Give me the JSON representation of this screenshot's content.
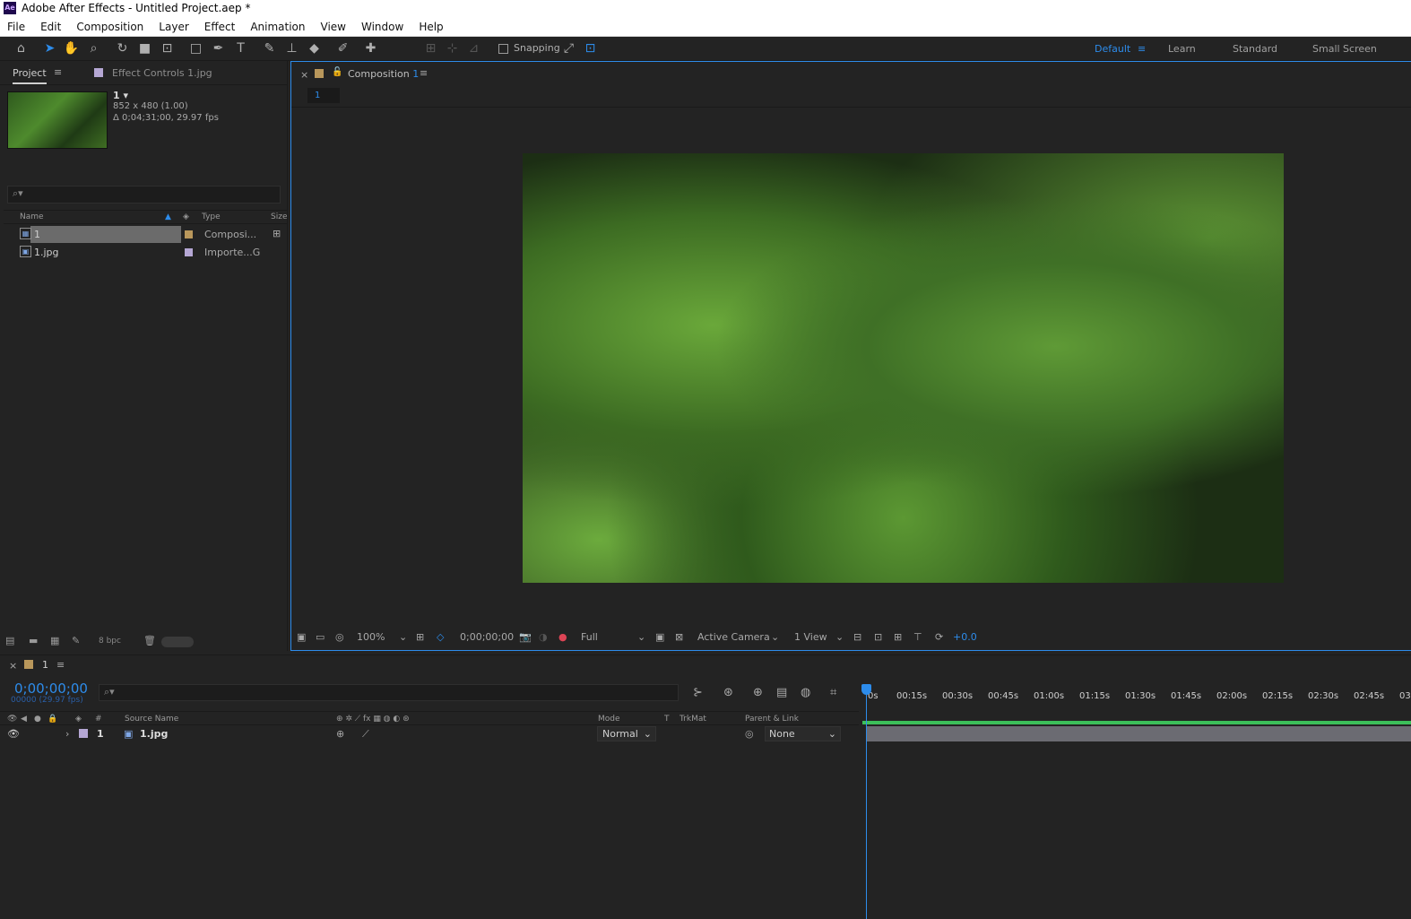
{
  "window": {
    "title": "Adobe After Effects - Untitled Project.aep *",
    "logo": "Ae"
  },
  "menu": [
    "File",
    "Edit",
    "Composition",
    "Layer",
    "Effect",
    "Animation",
    "View",
    "Window",
    "Help"
  ],
  "toolbar": {
    "snapping_label": "Snapping",
    "workspaces": [
      "Default",
      "Learn",
      "Standard",
      "Small Screen"
    ],
    "accent": "#2d8ceb"
  },
  "project": {
    "tab": "Project",
    "effect_controls_tab": "Effect Controls 1.jpg",
    "comp_name": "1 ▾",
    "comp_size": "852 x 480 (1.00)",
    "comp_duration": "Δ 0;04;31;00, 29.97 fps",
    "columns": {
      "name": "Name",
      "type": "Type",
      "size": "Size"
    },
    "items": [
      {
        "name": "1",
        "type": "Composi...",
        "tag_color": "#b9975b",
        "icon": "composition-icon"
      },
      {
        "name": "1.jpg",
        "type": "Importe...G",
        "tag_color": "#b5a7d4",
        "icon": "image-file-icon"
      }
    ],
    "bpc": "8 bpc"
  },
  "composition": {
    "tab_label": "Composition",
    "tab_number": "1",
    "breadcrumb": "1",
    "zoom": "100%",
    "timecode": "0;00;00;00",
    "resolution": "Full",
    "camera": "Active Camera",
    "views": "1 View",
    "exposure": "+0.0"
  },
  "timeline": {
    "tab_label": "1",
    "timecode": "0;00;00;00",
    "frames": "00000 (29.97 fps)",
    "ruler": [
      "0s",
      "00:15s",
      "00:30s",
      "00:45s",
      "01:00s",
      "01:15s",
      "01:30s",
      "01:45s",
      "02:00s",
      "02:15s",
      "02:30s",
      "02:45s",
      "03"
    ],
    "headers": {
      "num": "#",
      "source": "Source Name",
      "mode": "Mode",
      "t": "T",
      "trkmat": "TrkMat",
      "parent": "Parent & Link"
    },
    "layer": {
      "index": "1",
      "name": "1.jpg",
      "mode": "Normal",
      "parent": "None"
    }
  }
}
